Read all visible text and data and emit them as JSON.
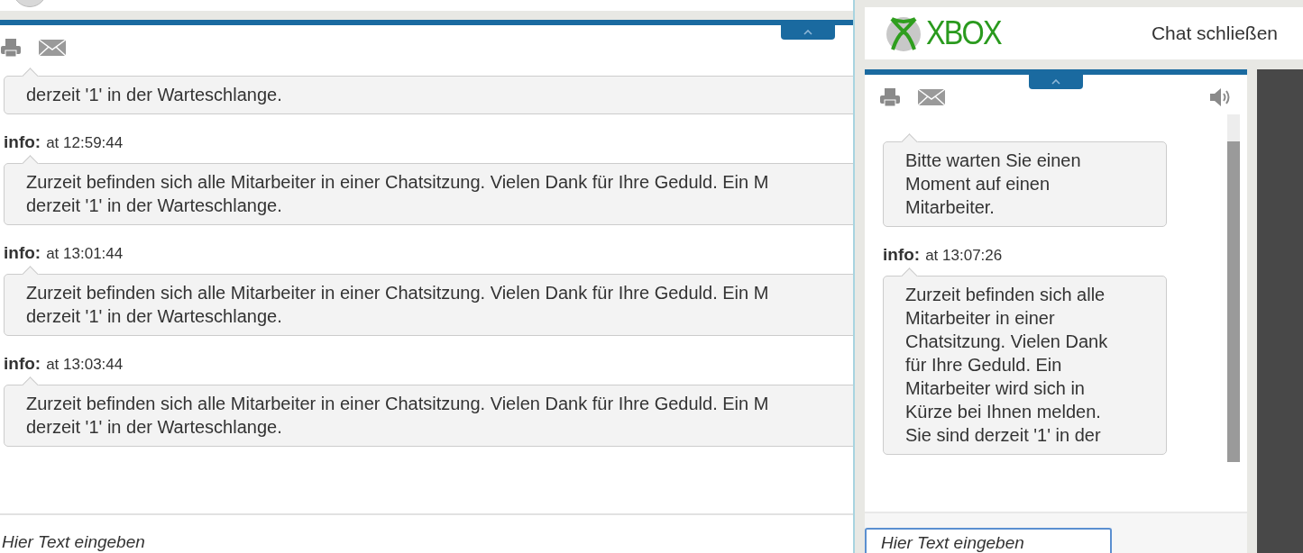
{
  "main_chat": {
    "messages": [
      {
        "lines": [
          "derzeit '1' in der Warteschlange."
        ]
      },
      {
        "sender": "info:",
        "time": "at 12:59:44",
        "lines": [
          "Zurzeit befinden sich alle Mitarbeiter in einer Chatsitzung. Vielen Dank für Ihre Geduld. Ein M",
          "derzeit '1' in der Warteschlange."
        ]
      },
      {
        "sender": "info:",
        "time": "at 13:01:44",
        "lines": [
          "Zurzeit befinden sich alle Mitarbeiter in einer Chatsitzung. Vielen Dank für Ihre Geduld. Ein M",
          "derzeit '1' in der Warteschlange."
        ]
      },
      {
        "sender": "info:",
        "time": "at 13:03:44",
        "lines": [
          "Zurzeit befinden sich alle Mitarbeiter in einer Chatsitzung. Vielen Dank für Ihre Geduld. Ein M",
          "derzeit '1' in der Warteschlange."
        ]
      }
    ],
    "input": {
      "placeholder": "Hier Text eingeben"
    }
  },
  "popup": {
    "logo_text": "XBOX",
    "close_link": "Chat schließen",
    "messages": [
      {
        "text": "Bitte warten Sie einen Moment auf einen Mitarbeiter."
      },
      {
        "sender": "info:",
        "time": "at 13:07:26",
        "text": "Zurzeit befinden sich alle Mitarbeiter in einer Chatsitzung. Vielen Dank für Ihre Geduld. Ein Mitarbeiter wird sich in Kürze bei Ihnen melden. Sie sind derzeit '1' in der"
      }
    ],
    "input": {
      "placeholder": "Hier Text eingeben"
    }
  }
}
